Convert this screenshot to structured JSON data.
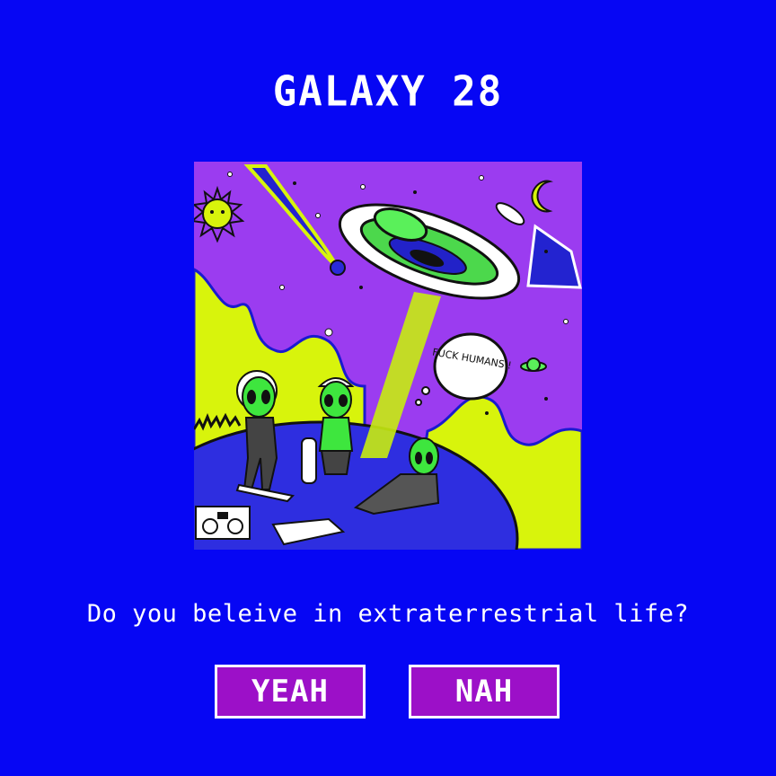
{
  "page": {
    "title": "GALAXY 28",
    "question": "Do you beleive in extraterrestrial life?"
  },
  "illustration": {
    "speech_bubble_text": "FUCK HUMANS !"
  },
  "buttons": {
    "yes_label": "YEAH",
    "no_label": "NAH"
  },
  "colors": {
    "background": "#0606f4",
    "button": "#9c10c8",
    "art_sky": "#9b3cf0",
    "art_lime": "#d8f40c",
    "alien_green": "#3ee63e"
  }
}
